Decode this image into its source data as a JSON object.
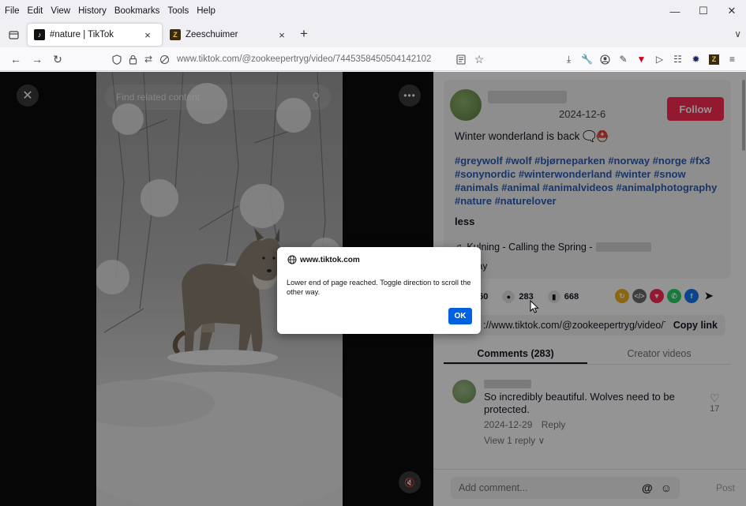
{
  "menubar": {
    "items": [
      "File",
      "Edit",
      "View",
      "History",
      "Bookmarks",
      "Tools",
      "Help"
    ]
  },
  "window_controls": {
    "minimize": "—",
    "maximize": "☐",
    "close": "✕"
  },
  "tabs": [
    {
      "title": "#nature | TikTok",
      "favicon": "tiktok-icon",
      "active": true,
      "close": "×"
    },
    {
      "title": "Zeeschuimer",
      "favicon": "zeeschuimer-icon",
      "active": false,
      "close": "×"
    }
  ],
  "new_tab": "+",
  "tab_overflow": "∨",
  "navbar": {
    "url_host": "www.tiktok.com",
    "url_path": "/@zookeepertryg/video/7445358450504142102"
  },
  "video": {
    "search_placeholder": "Find related content"
  },
  "post": {
    "date": "2024-12-6",
    "follow_label": "Follow",
    "caption": "Winter wonderland is back 🗨️⛑️",
    "hashtags": "#greywolf #wolf #bjørneparken #norway #norge #fx3 #sonynordic #winterwonderland #winter #snow #animals #animal #animalvideos #animalphotography #nature #naturelover",
    "less_label": "less",
    "music_title": "Kulning - Calling the Spring -",
    "music_sub": "rway",
    "stats": {
      "likes": "050",
      "comments": "283",
      "saves": "668"
    },
    "link_text": "://www.tiktok.com/@zookeepertryg/video/744...",
    "copy_link_label": "Copy link"
  },
  "content_tabs": {
    "comments": "Comments (283)",
    "creator": "Creator videos"
  },
  "comment": {
    "text": "So incredibly beautiful. Wolves need to be protected.",
    "date": "2024-12-29",
    "reply": "Reply",
    "view_replies": "View 1 reply ∨",
    "likes": "17"
  },
  "add_comment": {
    "placeholder": "Add comment...",
    "at": "@",
    "post": "Post"
  },
  "dialog": {
    "origin": "www.tiktok.com",
    "message": "Lower end of page reached. Toggle direction to scroll the other way.",
    "ok": "OK"
  },
  "colors": {
    "follow": "#fe2c55",
    "hashtag": "#2b5db9",
    "ok_button": "#0061e0"
  }
}
